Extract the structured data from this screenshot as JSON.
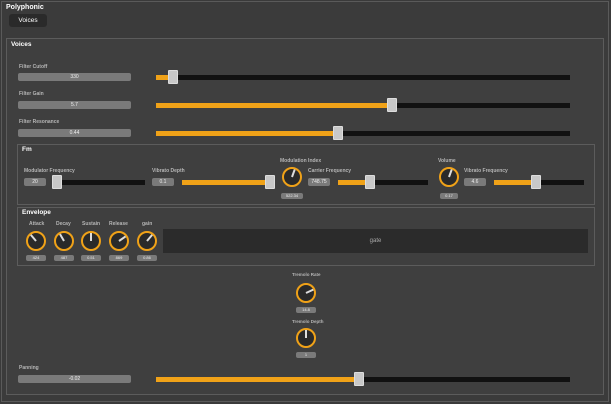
{
  "app": {
    "title": "Polyphonic",
    "tab": "Voices"
  },
  "voices": {
    "title": "Voices",
    "filter_cutoff": {
      "label": "Filter Cutoff",
      "value": "330",
      "fraction": 0.04
    },
    "filter_gain": {
      "label": "Filter Gain",
      "value": "5.7",
      "fraction": 0.57
    },
    "filter_resonance": {
      "label": "Filter Resonance",
      "value": "0.44",
      "fraction": 0.44
    },
    "panning": {
      "label": "Panning",
      "value": "-0.02",
      "fraction": 0.49
    }
  },
  "fm": {
    "title": "Fm",
    "modulator_frequency": {
      "label": "Modulator Frequency",
      "value": "20",
      "fraction": 0.01
    },
    "vibrato_depth": {
      "label": "Vibrato Depth",
      "value": "0.1",
      "fraction": 1.0
    },
    "modulation_index": {
      "label": "Modulation Index",
      "value": "522.34",
      "angle": 200
    },
    "carrier_frequency": {
      "label": "Carrier Frequency",
      "value": "748.75",
      "fraction": 0.36
    },
    "volume": {
      "label": "Volume",
      "value": "0.17",
      "angle": 200
    },
    "vibrato_frequency": {
      "label": "Vibrato Frequency",
      "value": "4.6",
      "fraction": 0.47
    }
  },
  "envelope": {
    "title": "Envelope",
    "gate_label": "gate",
    "knobs": [
      {
        "label": "Attack",
        "value": "424",
        "angle": 140
      },
      {
        "label": "Decay",
        "value": "487",
        "angle": 150
      },
      {
        "label": "Sustain",
        "value": "0.51",
        "angle": 180
      },
      {
        "label": "Release",
        "value": "869",
        "angle": 235
      },
      {
        "label": "gain",
        "value": "0.86",
        "angle": 220
      }
    ]
  },
  "tremolo": {
    "rate": {
      "label": "Tremolo Rate",
      "value": "14.8",
      "angle": 245
    },
    "depth": {
      "label": "Tremolo Depth",
      "value": "1",
      "angle": 180
    }
  },
  "colors": {
    "accent": "#f0a218",
    "track": "#111111",
    "panel": "#3f3f3f"
  }
}
